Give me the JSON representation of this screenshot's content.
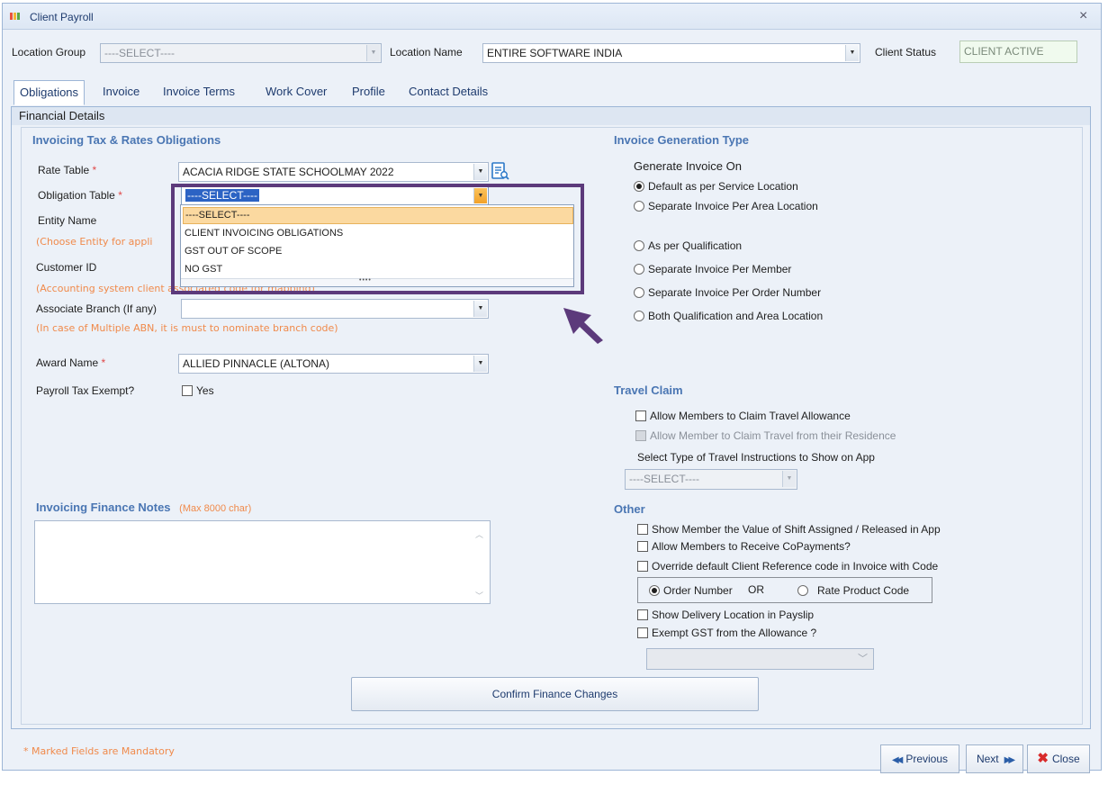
{
  "window": {
    "title": "Client Payroll",
    "close": "×"
  },
  "top": {
    "location_group_label": "Location Group",
    "location_group_value": "----SELECT----",
    "location_name_label": "Location Name",
    "location_name_value": "ENTIRE SOFTWARE INDIA",
    "client_status_label": "Client Status",
    "client_status_value": "CLIENT ACTIVE"
  },
  "tabs": [
    "Obligations",
    "Invoice",
    "Invoice Terms",
    "Work Cover",
    "Profile",
    "Contact Details"
  ],
  "panel": {
    "header": "Financial Details"
  },
  "left": {
    "title": "Invoicing Tax & Rates Obligations",
    "rate_table_label": "Rate Table",
    "rate_table_value": "ACACIA RIDGE STATE SCHOOLMAY 2022",
    "obligation_table_label": "Obligation Table",
    "obligation_table_value": "----SELECT----",
    "entity_name_label": "Entity Name",
    "entity_hint": "(Choose Entity for appli",
    "customer_id_label": "Customer ID",
    "customer_hint": "(Accounting system client associated code for mapping)",
    "associate_branch_label": "Associate Branch (If any)",
    "branch_hint": "(In case of Multiple ABN, it is must to nominate branch code)",
    "award_name_label": "Award Name",
    "award_name_value": "ALLIED PINNACLE (ALTONA)",
    "payroll_tax_label": "Payroll Tax Exempt?",
    "payroll_tax_option": "Yes",
    "required_mark": "*",
    "notes_title": "Invoicing Finance Notes",
    "notes_hint": "(Max 8000 char)"
  },
  "dropdown": {
    "items": [
      "----SELECT----",
      "CLIENT INVOICING OBLIGATIONS",
      "GST OUT OF SCOPE",
      "NO GST"
    ],
    "grip": "••••"
  },
  "invoice_gen": {
    "title": "Invoice Generation Type",
    "subtitle": "Generate Invoice On",
    "options": [
      "Default as per Service Location",
      "Separate Invoice Per Area Location",
      "As per Qualification",
      "Separate Invoice Per Member",
      "Separate Invoice Per Order Number",
      "Both Qualification and Area Location"
    ]
  },
  "travel": {
    "title": "Travel Claim",
    "allow_travel": "Allow Members to Claim Travel Allowance",
    "allow_residence": "Allow Member to Claim Travel from their Residence",
    "select_type_label": "Select Type of Travel Instructions to Show on App",
    "select_value": "----SELECT----"
  },
  "other": {
    "title": "Other",
    "show_value": "Show Member the Value of Shift Assigned / Released in App",
    "allow_copay": "Allow Members to Receive CoPayments?",
    "override_ref": "Override default Client Reference code in Invoice with Code",
    "order_number": "Order Number",
    "or": "OR",
    "rate_product": "Rate Product Code",
    "show_delivery": "Show Delivery Location in Payslip",
    "exempt_gst": "Exempt GST from the Allowance ?"
  },
  "buttons": {
    "confirm": "Confirm Finance Changes",
    "previous": "Previous",
    "next": "Next",
    "close": "Close"
  },
  "footer": {
    "mandatory_note": "* Marked Fields are Mandatory"
  },
  "colors": {
    "accent": "#4a76b3",
    "hint": "#f08a4b",
    "highlight_frame": "#5c3a7b",
    "selected_item": "#fbd9a0"
  }
}
